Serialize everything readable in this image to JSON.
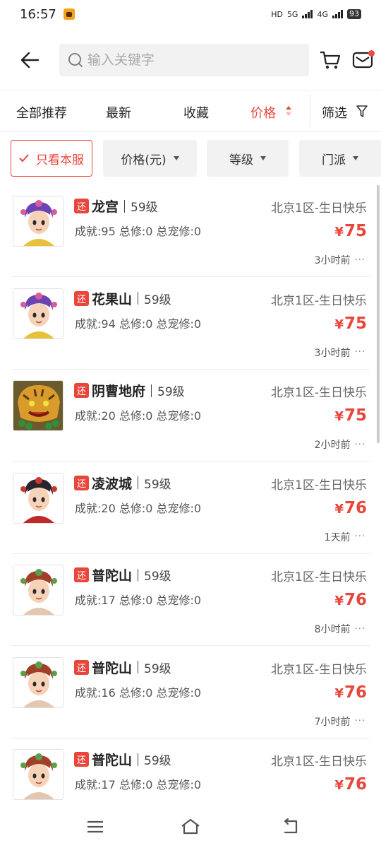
{
  "status_bar": {
    "time": "16:57",
    "hd": "HD",
    "net1": "5G",
    "net2": "4G",
    "battery": "93"
  },
  "header": {
    "search_placeholder": "输入关键字",
    "icons": [
      "back-arrow-icon",
      "search-icon",
      "cart-icon",
      "mail-icon"
    ],
    "mail_badge": true
  },
  "sort_tabs": {
    "all": "全部推荐",
    "newest": "最新",
    "favorites": "收藏",
    "price": "价格",
    "filter": "筛选",
    "active": "price",
    "accent_color": "#e8463b"
  },
  "chips": {
    "only_this_server": "只看本服",
    "price": "价格(元)",
    "grade": "等级",
    "school": "门派"
  },
  "items": [
    {
      "tag": "还",
      "school": "龙宫",
      "level": "59级",
      "stats": "成就:95 总修:0 总宠修:0",
      "server": "北京1区-生日快乐",
      "price": "75",
      "time": "3小时前",
      "avatar": "purple-hair-girl"
    },
    {
      "tag": "还",
      "school": "花果山",
      "level": "59级",
      "stats": "成就:94 总修:0 总宠修:0",
      "server": "北京1区-生日快乐",
      "price": "75",
      "time": "3小时前",
      "avatar": "purple-hair-girl"
    },
    {
      "tag": "还",
      "school": "阴曹地府",
      "level": "59级",
      "stats": "成就:20 总修:0 总宠修:0",
      "server": "北京1区-生日快乐",
      "price": "75",
      "time": "2小时前",
      "avatar": "tiger-beast"
    },
    {
      "tag": "还",
      "school": "凌波城",
      "level": "59级",
      "stats": "成就:20 总修:0 总宠修:0",
      "server": "北京1区-生日快乐",
      "price": "76",
      "time": "1天前",
      "avatar": "dark-hair-boy"
    },
    {
      "tag": "还",
      "school": "普陀山",
      "level": "59级",
      "stats": "成就:17 总修:0 总宠修:0",
      "server": "北京1区-生日快乐",
      "price": "76",
      "time": "8小时前",
      "avatar": "red-hair-girl"
    },
    {
      "tag": "还",
      "school": "普陀山",
      "level": "59级",
      "stats": "成就:16 总修:0 总宠修:0",
      "server": "北京1区-生日快乐",
      "price": "76",
      "time": "7小时前",
      "avatar": "red-hair-girl"
    },
    {
      "tag": "还",
      "school": "普陀山",
      "level": "59级",
      "stats": "成就:17 总修:0 总宠修:0",
      "server": "北京1区-生日快乐",
      "price": "76",
      "time": "",
      "avatar": "red-hair-girl"
    }
  ],
  "currency": "¥",
  "more_glyph": "···",
  "navbar": {
    "icons": [
      "menu-icon",
      "home-icon",
      "back-icon"
    ]
  }
}
